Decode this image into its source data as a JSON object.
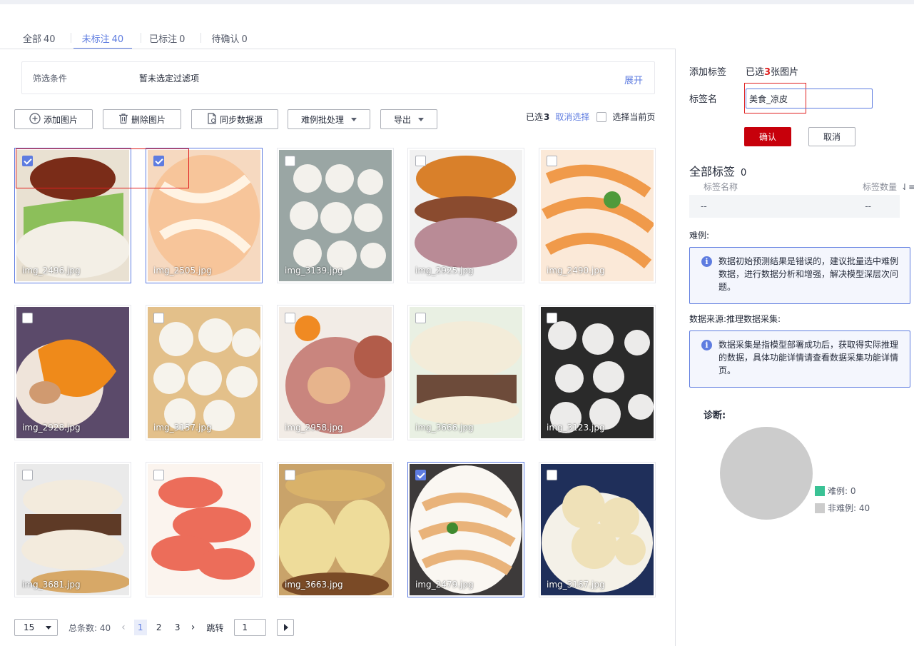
{
  "tabs": [
    {
      "label": "全部",
      "count": "40"
    },
    {
      "label": "未标注",
      "count": "40"
    },
    {
      "label": "已标注",
      "count": "0"
    },
    {
      "label": "待确认",
      "count": "0"
    }
  ],
  "filter": {
    "label": "筛选条件",
    "value": "暂未选定过滤项",
    "expand": "展开"
  },
  "toolbar": {
    "add_image": "添加图片",
    "delete_image": "删除图片",
    "sync_source": "同步数据源",
    "hard_batch": "难例批处理",
    "export": "导出"
  },
  "selection": {
    "prefix": "已选",
    "count": "3",
    "cancel": "取消选择",
    "select_page": "选择当前页"
  },
  "images": [
    {
      "name": "img_2496.jpg",
      "selected": true
    },
    {
      "name": "img_2505.jpg",
      "selected": true
    },
    {
      "name": "img_3139.jpg",
      "selected": false
    },
    {
      "name": "img_2925.jpg",
      "selected": false
    },
    {
      "name": "img_2490.jpg",
      "selected": false
    },
    {
      "name": "img_2928.jpg",
      "selected": false
    },
    {
      "name": "img_3157.jpg",
      "selected": false
    },
    {
      "name": "img_2958.jpg",
      "selected": false
    },
    {
      "name": "img_3666.jpg",
      "selected": false
    },
    {
      "name": "img_3123.jpg",
      "selected": false
    },
    {
      "name": "img_3681.jpg",
      "selected": false
    },
    {
      "name": "",
      "selected": false
    },
    {
      "name": "img_3663.jpg",
      "selected": false
    },
    {
      "name": "img_2479.jpg",
      "selected": true
    },
    {
      "name": "img_3167.jpg",
      "selected": false
    }
  ],
  "pager": {
    "page_size": "15",
    "total_label": "总条数: 40",
    "pages": [
      "1",
      "2",
      "3"
    ],
    "current_page": "1",
    "jump_label": "跳转",
    "jump_value": "1"
  },
  "panel": {
    "add_tag_label": "添加标签",
    "selected_prefix": "已选",
    "selected_count": "3",
    "selected_suffix": "张图片",
    "tag_name_label": "标签名",
    "tag_name_value": "美食_凉皮",
    "confirm": "确认",
    "cancel": "取消",
    "all_tags_label": "全部标签",
    "all_tags_count": "0",
    "col_name": "标签名称",
    "col_count": "标签数量",
    "empty_name": "--",
    "empty_count": "--",
    "hard_label": "难例:",
    "hard_info": "数据初始预测结果是错误的，建议批量选中难例数据，进行数据分析和增强，解决模型深层次问题。",
    "source_label": "数据来源:推理数据采集:",
    "source_info": "数据采集是指模型部署成功后，获取得实际推理的数据，具体功能详情请查看数据采集功能详情页。",
    "diagnosis_label": "诊断:",
    "legend_hard": "难例: 0",
    "legend_nonhard": "非难例: 40"
  },
  "colors": {
    "accent": "#5e7ce0",
    "confirm": "#c7000b",
    "hard": "#3ac295",
    "nonhard": "#cccccc"
  },
  "diagnosis": {
    "hard": 0,
    "nonhard": 40
  }
}
